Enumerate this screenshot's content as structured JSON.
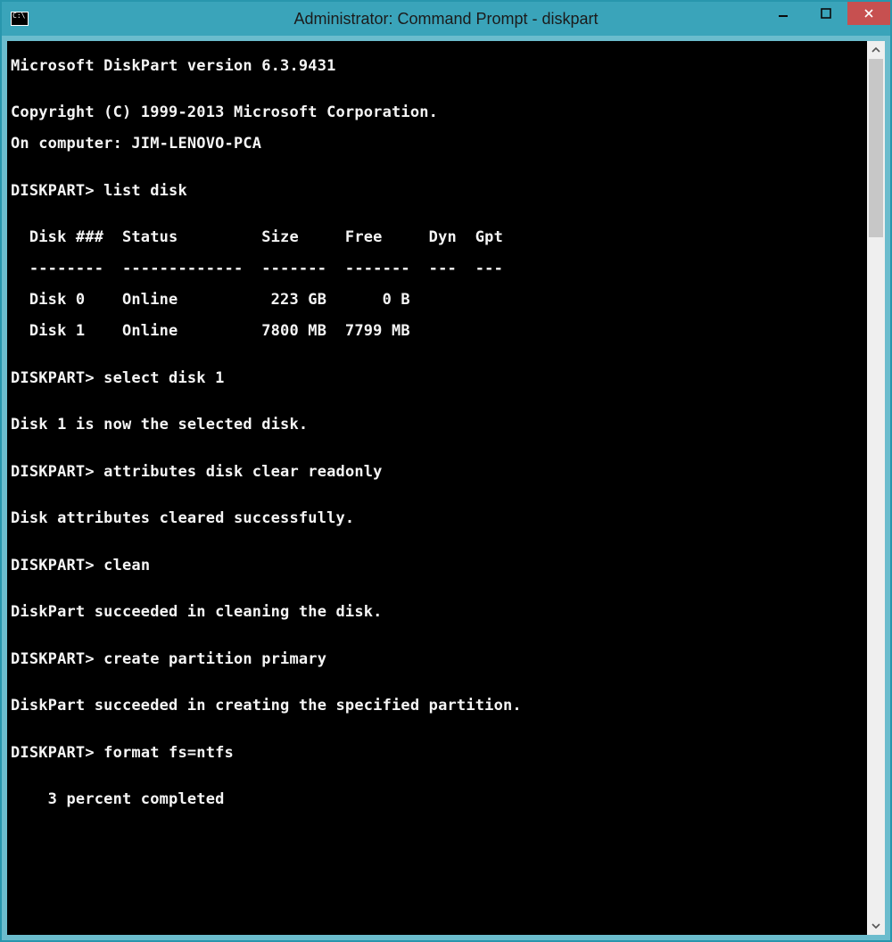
{
  "window": {
    "title": "Administrator: Command Prompt - diskpart"
  },
  "console": {
    "version_line": "Microsoft DiskPart version 6.3.9431",
    "blank": "",
    "copyright": "Copyright (C) 1999-2013 Microsoft Corporation.",
    "on_computer": "On computer: JIM-LENOVO-PCA",
    "prompt": "DISKPART>",
    "cmd_list_disk": "list disk",
    "tbl_header": "  Disk ###  Status         Size     Free     Dyn  Gpt",
    "tbl_divider": "  --------  -------------  -------  -------  ---  ---",
    "tbl_row0": "  Disk 0    Online          223 GB      0 B",
    "tbl_row1": "  Disk 1    Online         7800 MB  7799 MB",
    "cmd_select": "select disk 1",
    "resp_select": "Disk 1 is now the selected disk.",
    "cmd_attr": "attributes disk clear readonly",
    "resp_attr": "Disk attributes cleared successfully.",
    "cmd_clean": "clean",
    "resp_clean": "DiskPart succeeded in cleaning the disk.",
    "cmd_create": "create partition primary",
    "resp_create": "DiskPart succeeded in creating the specified partition.",
    "cmd_format": "format fs=ntfs",
    "progress": "    3 percent completed",
    "disks": [
      {
        "id": "Disk 0",
        "status": "Online",
        "size": "223 GB",
        "free": "0 B",
        "dyn": "",
        "gpt": ""
      },
      {
        "id": "Disk 1",
        "status": "Online",
        "size": "7800 MB",
        "free": "7799 MB",
        "dyn": "",
        "gpt": ""
      }
    ]
  }
}
